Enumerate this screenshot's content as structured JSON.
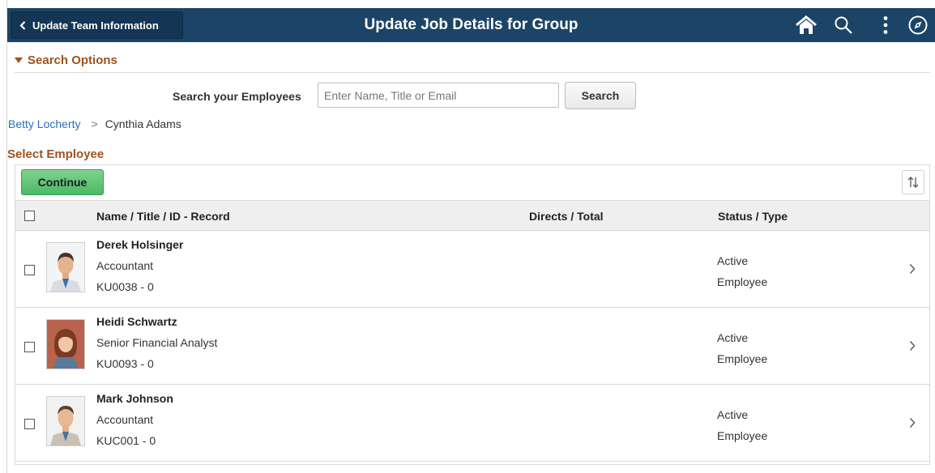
{
  "header": {
    "back_label": "Update Team Information",
    "title": "Update Job Details for Group",
    "icons": [
      "home-icon",
      "search-icon",
      "more-icon",
      "navbar-icon"
    ],
    "color": "#1c4466"
  },
  "search": {
    "section_label": "Search Options",
    "field_label": "Search your Employees",
    "placeholder": "Enter Name, Title or Email",
    "value": "",
    "button_label": "Search"
  },
  "breadcrumb": {
    "items": [
      "Betty Locherty",
      "Cynthia Adams"
    ],
    "separator": ">"
  },
  "grid": {
    "title": "Select Employee",
    "continue_label": "Continue",
    "columns": [
      "Name / Title / ID - Record",
      "Directs / Total",
      "Status / Type"
    ],
    "rows": [
      {
        "name": "Derek Holsinger",
        "title": "Accountant",
        "id_record": "KU0038 - 0",
        "status": "Active",
        "type": "Employee"
      },
      {
        "name": "Heidi Schwartz",
        "title": "Senior Financial Analyst",
        "id_record": "KU0093 - 0",
        "status": "Active",
        "type": "Employee"
      },
      {
        "name": "Mark Johnson",
        "title": "Accountant",
        "id_record": "KUC001 - 0",
        "status": "Active",
        "type": "Employee"
      }
    ]
  },
  "colors": {
    "accent": "#a0521d",
    "link": "#2a6ebb",
    "continue_button": "#4bb964"
  }
}
